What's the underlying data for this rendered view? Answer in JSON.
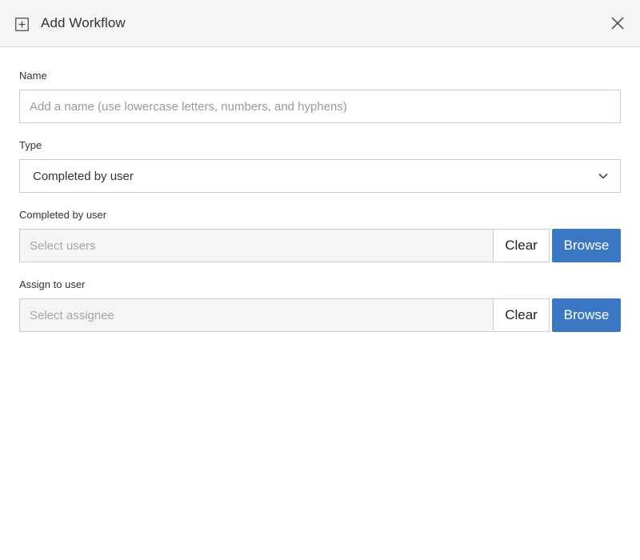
{
  "dialog": {
    "title": "Add Workflow",
    "header_icon": "plus-square-icon",
    "close_icon": "close-icon"
  },
  "form": {
    "name": {
      "label": "Name",
      "value": "",
      "placeholder": "Add a name (use lowercase letters, numbers, and hyphens)"
    },
    "type": {
      "label": "Type",
      "selected": "Completed by user",
      "icon": "chevron-down-icon"
    },
    "completed_by_user": {
      "label": "Completed by user",
      "value": "",
      "placeholder": "Select users",
      "clear_label": "Clear",
      "browse_label": "Browse"
    },
    "assign_to_user": {
      "label": "Assign to user",
      "value": "",
      "placeholder": "Select assignee",
      "clear_label": "Clear",
      "browse_label": "Browse"
    }
  },
  "colors": {
    "header_bg": "#f5f5f5",
    "primary_button": "#3a78c3",
    "border": "#cccccc",
    "disabled_input_bg": "#f5f5f5"
  }
}
